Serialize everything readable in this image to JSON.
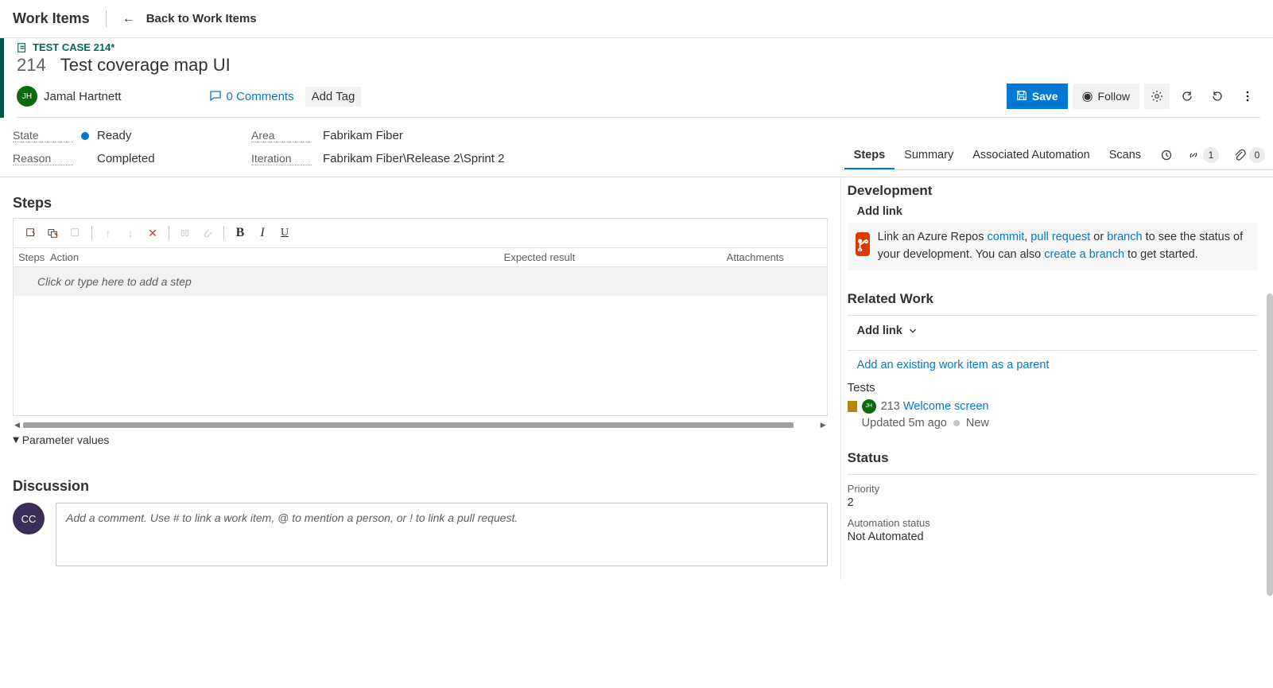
{
  "header": {
    "page": "Work Items",
    "back": "Back to Work Items"
  },
  "workItem": {
    "typeLabel": "TEST CASE 214*",
    "id": "214",
    "title": "Test coverage map UI",
    "assignee": "Jamal Hartnett",
    "assigneeInitials": "JH",
    "comments": "0 Comments",
    "addTag": "Add Tag"
  },
  "actions": {
    "save": "Save",
    "follow": "Follow"
  },
  "fields": {
    "stateLabel": "State",
    "state": "Ready",
    "reasonLabel": "Reason",
    "reason": "Completed",
    "areaLabel": "Area",
    "area": "Fabrikam Fiber",
    "iterationLabel": "Iteration",
    "iteration": "Fabrikam Fiber\\Release 2\\Sprint 2"
  },
  "steps": {
    "title": "Steps",
    "columns": {
      "step": "Steps",
      "action": "Action",
      "expected": "Expected result",
      "attachments": "Attachments"
    },
    "placeholder": "Click or type here to add a step",
    "paramValues": "Parameter values"
  },
  "discussion": {
    "title": "Discussion",
    "avatar": "CC",
    "placeholder": "Add a comment. Use # to link a work item, @ to mention a person, or ! to link a pull request."
  },
  "tabs": [
    "Steps",
    "Summary",
    "Associated Automation",
    "Scans"
  ],
  "linkBadge": "1",
  "attachBadge": "0",
  "development": {
    "title": "Development",
    "addLink": "Add link",
    "textParts": {
      "pre": "Link an Azure Repos ",
      "commit": "commit",
      "sep1": ", ",
      "pr": "pull request",
      "or": " or ",
      "branch": "branch",
      "mid": " to see the status of your development. You can also ",
      "create": "create a branch",
      "end": " to get started."
    }
  },
  "related": {
    "title": "Related Work",
    "addLink": "Add link",
    "existing": "Add an existing work item as a parent",
    "testsTitle": "Tests",
    "testId": "213",
    "testName": "Welcome screen",
    "updated": "Updated 5m ago",
    "state": "New"
  },
  "status": {
    "title": "Status",
    "priorityLabel": "Priority",
    "priority": "2",
    "autoLabel": "Automation status",
    "auto": "Not Automated"
  }
}
